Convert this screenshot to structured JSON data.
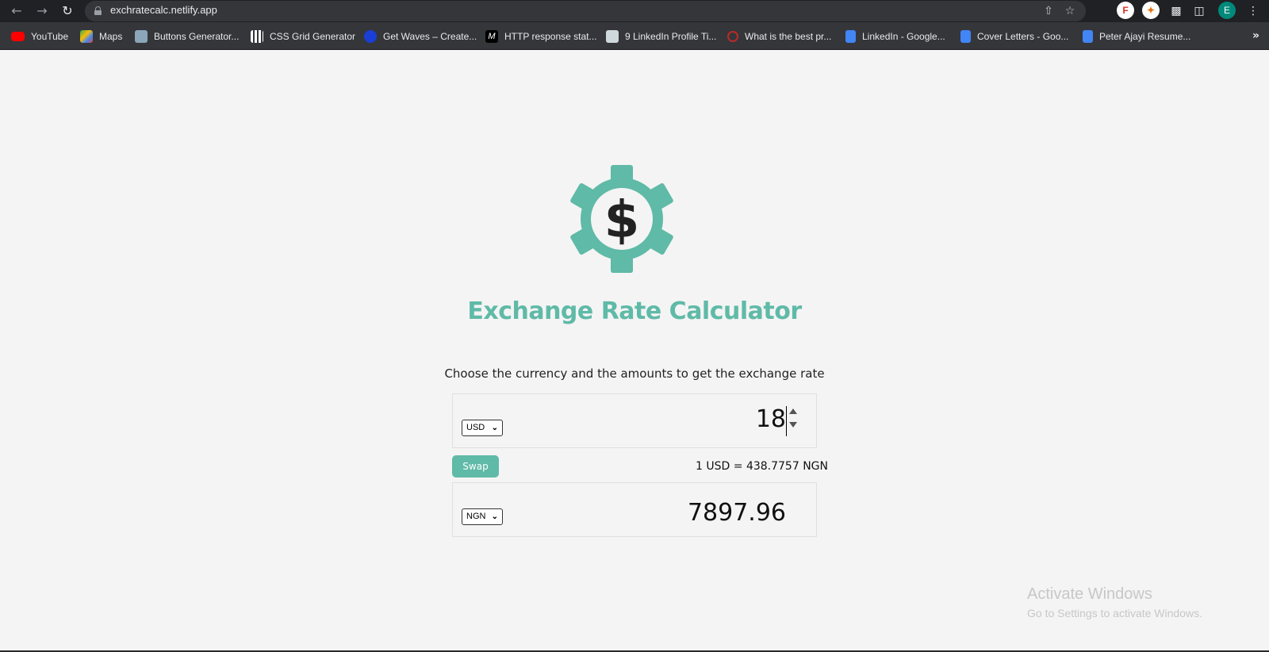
{
  "browser": {
    "url": "exchratecalc.netlify.app",
    "profile_initial": "E",
    "bookmarks": [
      {
        "label": "YouTube",
        "icon": "youtube-icon"
      },
      {
        "label": "Maps",
        "icon": "maps-icon"
      },
      {
        "label": "Buttons Generator...",
        "icon": "buttons-generator-icon"
      },
      {
        "label": "CSS Grid Generator",
        "icon": "css-grid-icon"
      },
      {
        "label": "Get Waves – Create...",
        "icon": "get-waves-icon"
      },
      {
        "label": "HTTP response stat...",
        "icon": "mdn-icon"
      },
      {
        "label": "9 LinkedIn Profile Ti...",
        "icon": "linkedin-tips-icon"
      },
      {
        "label": "What is the best pr...",
        "icon": "quora-icon"
      },
      {
        "label": "LinkedIn - Google...",
        "icon": "google-docs-icon"
      },
      {
        "label": "Cover Letters - Goo...",
        "icon": "google-docs-icon"
      },
      {
        "label": "Peter Ajayi Resume...",
        "icon": "google-docs-icon"
      }
    ]
  },
  "app": {
    "title": "Exchange Rate Calculator",
    "subtitle": "Choose the currency and the amounts to get the exchange rate",
    "currency_one": {
      "code": "USD",
      "amount": "18"
    },
    "currency_two": {
      "code": "NGN",
      "amount": "7897.96"
    },
    "swap_label": "Swap",
    "rate_text": "1 USD = 438.7757 NGN",
    "accent_color": "#5fbaa7"
  },
  "os": {
    "watermark_title": "Activate Windows",
    "watermark_sub": "Go to Settings to activate Windows."
  }
}
